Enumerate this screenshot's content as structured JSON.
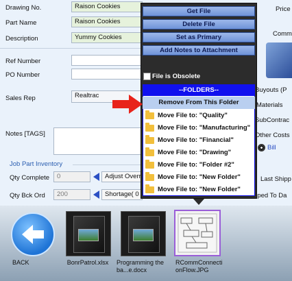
{
  "form": {
    "drawing_no_label": "Drawing No.",
    "drawing_no_value": "Raison Cookies",
    "part_name_label": "Part Name",
    "part_name_value": "Raison Cookies",
    "description_label": "Description",
    "description_value": "Yummy Cookies",
    "ref_number_label": "Ref Number",
    "po_number_label": "PO Number",
    "sales_rep_label": "Sales Rep",
    "sales_rep_value": "Realtrac",
    "notes_label": "Notes [TAGS]",
    "job_part_inventory_label": "Job Part Inventory",
    "qty_complete_label": "Qty Complete",
    "qty_complete_value": "0",
    "adjust_overrun_label": "Adjust Overr",
    "qty_bck_ord_label": "Qty Bck Ord",
    "qty_bck_ord_value": "200",
    "shortage_label": "Shortage( 0"
  },
  "right_panel": {
    "price_label": "Price",
    "comm_label": "Comm",
    "buyouts_label": "Buyouts (P",
    "materials_label": "Materials",
    "subcontract_label": "SubContrac",
    "other_costs_label": "Other Costs",
    "bill_label": "Bill",
    "last_ship_label": "Last Shipp",
    "pped_to_da_label": "pped To Da"
  },
  "context_menu": {
    "buttons": [
      "Get File",
      "Delete File",
      "Set as Primary",
      "Add Notes to Attachment"
    ],
    "obsolete_label": "File is Obsolete",
    "folders_header": "--FOLDERS--",
    "remove_from_folder": "Remove From This Folder",
    "move_items": [
      "Move File to: \"Quality\"",
      "Move File to: \"Manufacturing\"",
      "Move File to: \"Financial\"",
      "Move File to: \"Drawing\"",
      "Move File to: \"Folder #2\"",
      "Move File to: \"New Folder\"",
      "Move File to: \"New Folder\""
    ]
  },
  "file_strip": {
    "back_label": "BACK",
    "files": [
      {
        "name": "BonrPatrol.xlsx"
      },
      {
        "name": "Programming the ba...e.docx"
      },
      {
        "name": "RCommConnectionFlow.JPG"
      }
    ]
  },
  "colors": {
    "menu_header_bg": "#1010ee",
    "menu_highlight_bg": "#b9cff0",
    "arrow_red": "#e8231a",
    "selected_file_border": "#9a5ed8"
  }
}
